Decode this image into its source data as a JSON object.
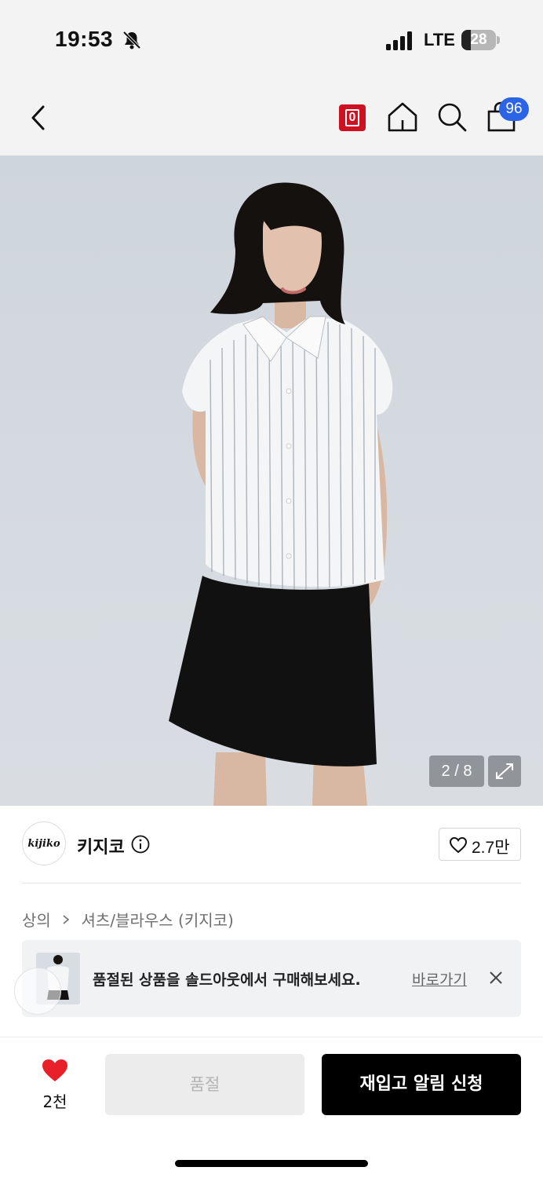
{
  "status_bar": {
    "time": "19:53",
    "network": "LTE",
    "battery": "28",
    "battery_level": 0.28
  },
  "nav": {
    "badge_label": "0",
    "badge_color": "#cf1020",
    "cart_count": "96",
    "cart_badge_color": "#2c64e8",
    "icons": [
      "back-icon",
      "home-icon",
      "search-icon",
      "shopping-bag-icon"
    ]
  },
  "gallery": {
    "counter": "2 / 8",
    "expand_icon": "expand-icon"
  },
  "brand": {
    "logo_text": "kijiko",
    "name": "키지코",
    "like_count": "2.7만"
  },
  "breadcrumb": {
    "category": "상의",
    "subcategory": "셔츠/블라우스 (키지코)"
  },
  "banner": {
    "message": "품절된 상품을 솔드아웃에서 구매해보세요.",
    "link": "바로가기"
  },
  "bottom_bar": {
    "wish_count": "2천",
    "soldout_label": "품절",
    "restock_label": "재입고 알림 신청",
    "accent_color": "#e8202a"
  }
}
